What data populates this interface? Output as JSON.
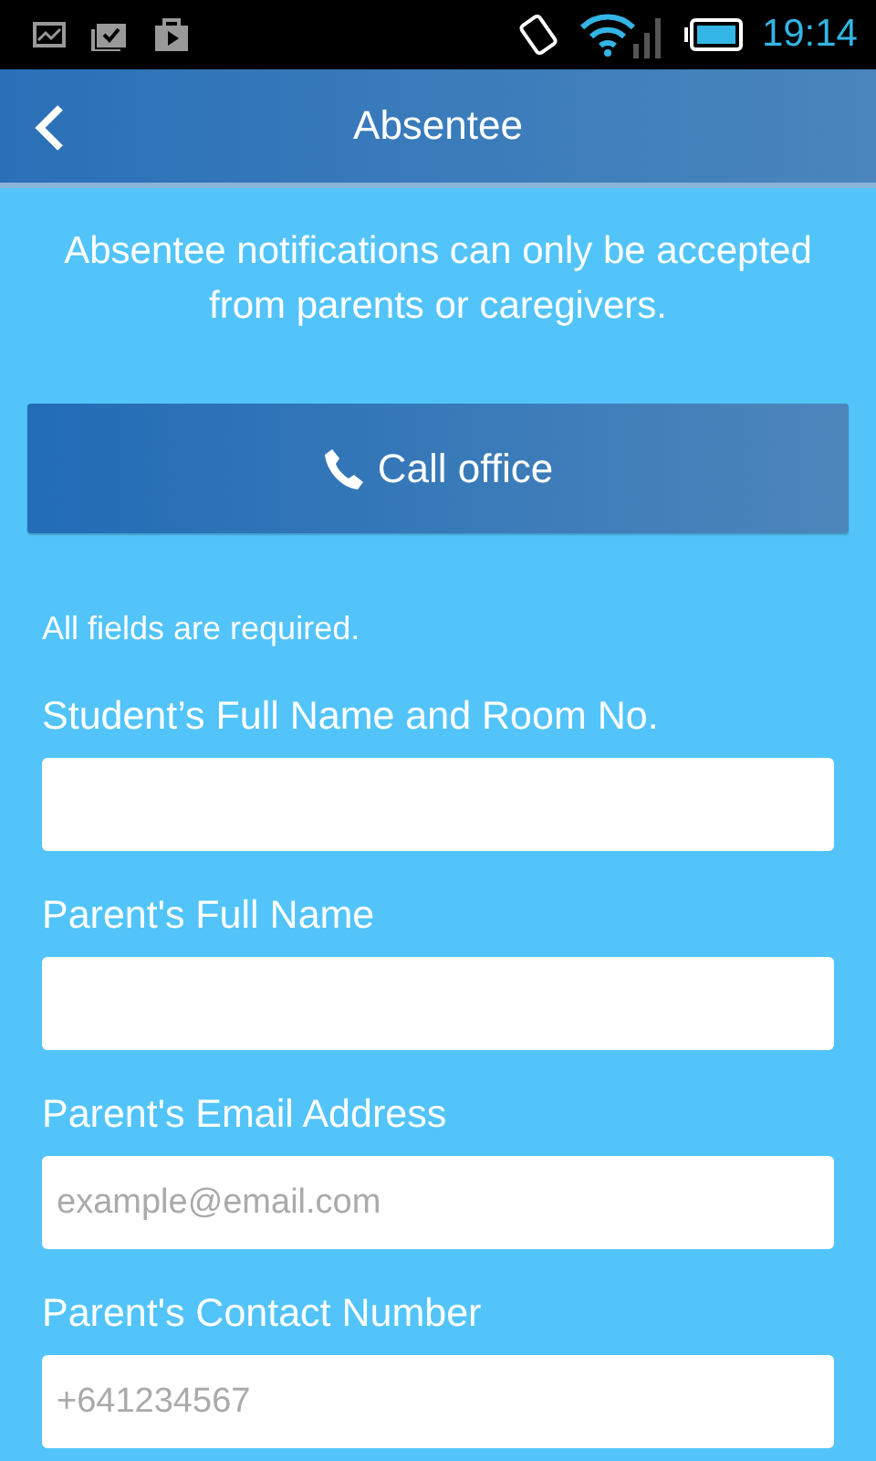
{
  "status_bar": {
    "time": "19:14"
  },
  "header": {
    "title": "Absentee"
  },
  "notice": "Absentee notifications can only be accepted from parents or caregivers.",
  "call_button": {
    "label": "Call office"
  },
  "required_note": "All fields are required.",
  "fields": [
    {
      "label": "Student’s Full Name and Room No."
    },
    {
      "label": "Parent's Full Name"
    },
    {
      "label": "Parent's Email Address",
      "placeholder": "example@email.com"
    },
    {
      "label": "Parent's Contact Number",
      "placeholder": "+641234567"
    }
  ]
}
